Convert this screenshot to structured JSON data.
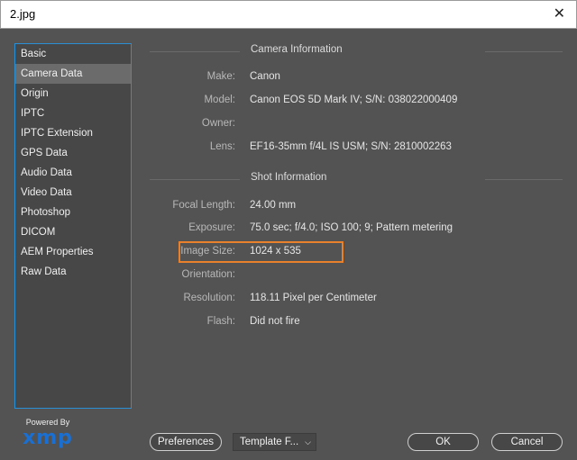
{
  "window": {
    "title": "2.jpg"
  },
  "sidebar": {
    "items": [
      {
        "label": "Basic"
      },
      {
        "label": "Camera Data",
        "active": true
      },
      {
        "label": "Origin"
      },
      {
        "label": "IPTC"
      },
      {
        "label": "IPTC Extension"
      },
      {
        "label": "GPS Data"
      },
      {
        "label": "Audio Data"
      },
      {
        "label": "Video Data"
      },
      {
        "label": "Photoshop"
      },
      {
        "label": "DICOM"
      },
      {
        "label": "AEM Properties"
      },
      {
        "label": "Raw Data"
      }
    ]
  },
  "branding": {
    "powered_by": "Powered By",
    "logo_text": "xmp",
    "logo_color": "#1a6fd0"
  },
  "camera_info": {
    "heading": "Camera Information",
    "fields": [
      {
        "label": "Make:",
        "value": "Canon"
      },
      {
        "label": "Model:",
        "value": "Canon EOS 5D Mark IV;   S/N: 038022000409"
      },
      {
        "label": "Owner:",
        "value": ""
      },
      {
        "label": "Lens:",
        "value": "EF16-35mm f/4L IS USM;   S/N: 2810002263"
      }
    ]
  },
  "shot_info": {
    "heading": "Shot Information",
    "fields": [
      {
        "label": "Focal Length:",
        "value": "24.00 mm"
      },
      {
        "label": "Exposure:",
        "value": "75.0 sec;   f/4.0;   ISO 100;   9;   Pattern metering"
      },
      {
        "label": "Image Size:",
        "value": "1024 x 535",
        "highlighted": true
      },
      {
        "label": "Orientation:",
        "value": ""
      },
      {
        "label": "Resolution:",
        "value": "118.11 Pixel per Centimeter"
      },
      {
        "label": "Flash:",
        "value": "Did not fire"
      }
    ]
  },
  "footer": {
    "preferences_label": "Preferences",
    "template_label": "Template F...",
    "ok_label": "OK",
    "cancel_label": "Cancel"
  },
  "colors": {
    "background": "#535353",
    "accent_border": "#2b8fd6",
    "highlight": "#e8802c"
  },
  "icons": {
    "close": "close-icon",
    "dropdown": "chevron-down-icon"
  }
}
